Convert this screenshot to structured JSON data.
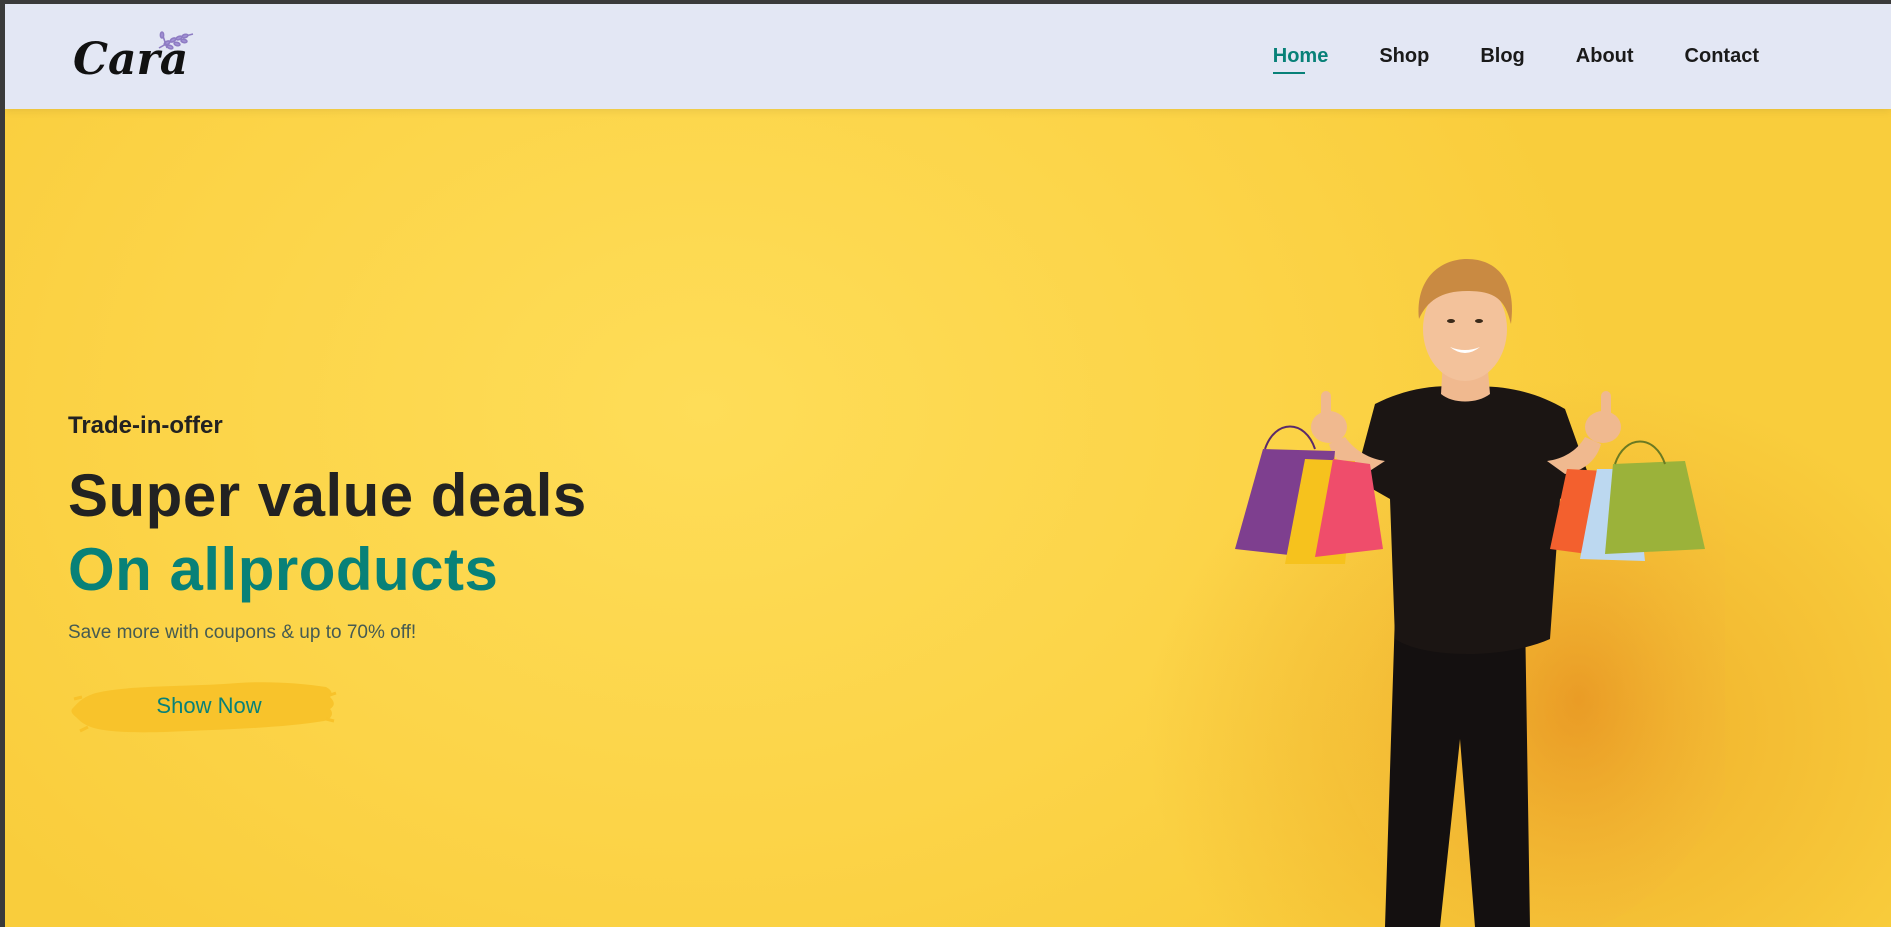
{
  "brand": {
    "logo_text": "Cara",
    "accent_color": "#088178",
    "hero_bg_color": "#fcd448",
    "header_bg_color": "#e3e7f4"
  },
  "nav": {
    "items": [
      {
        "label": "Home",
        "active": true
      },
      {
        "label": "Shop",
        "active": false
      },
      {
        "label": "Blog",
        "active": false
      },
      {
        "label": "About",
        "active": false
      },
      {
        "label": "Contact",
        "active": false
      }
    ]
  },
  "hero": {
    "tagline": "Trade-in-offer",
    "headline": "Super value deals",
    "headline_accent": "On allproducts",
    "subtext": "Save more with coupons & up to 70% off!",
    "cta_label": "Show Now"
  }
}
